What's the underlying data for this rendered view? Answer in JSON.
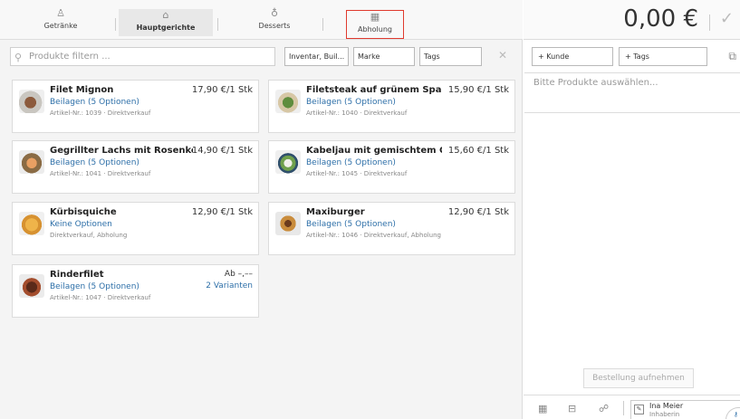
{
  "tabs": [
    {
      "label": "Getränke",
      "icon": "bottle-icon",
      "glyph": "♙"
    },
    {
      "label": "Hauptgerichte",
      "icon": "cloche-icon",
      "glyph": "⌂"
    },
    {
      "label": "Desserts",
      "icon": "ice-cream-icon",
      "glyph": "♁"
    },
    {
      "label": "Abholung",
      "icon": "calendar-box-icon",
      "glyph": "▦"
    }
  ],
  "filter": {
    "search_placeholder": "Produkte filtern ...",
    "inventory": "Inventar, Buil...",
    "brand": "Marke",
    "tags": "Tags",
    "clear": "✕"
  },
  "products": [
    {
      "name": "Filet Mignon",
      "price": "17,90 €/1 Stk",
      "options": "Beilagen (5 Optionen)",
      "meta": "Artikel-Nr.: 1039 · Direktverkauf"
    },
    {
      "name": "Filetsteak auf grünem Spargel",
      "price": "15,90 €/1 Stk",
      "options": "Beilagen (5 Optionen)",
      "meta": "Artikel-Nr.: 1040 · Direktverkauf"
    },
    {
      "name": "Gegrillter Lachs mit Rosenkohl",
      "price": "14,90 €/1 Stk",
      "options": "Beilagen (5 Optionen)",
      "meta": "Artikel-Nr.: 1041 · Direktverkauf"
    },
    {
      "name": "Kabeljau mit gemischtem Gem...",
      "price": "15,60 €/1 Stk",
      "options": "Beilagen (5 Optionen)",
      "meta": "Artikel-Nr.: 1045 · Direktverkauf"
    },
    {
      "name": "Kürbisquiche",
      "price": "12,90 €/1 Stk",
      "options": "Keine Optionen",
      "meta": "Direktverkauf, Abholung"
    },
    {
      "name": "Maxiburger",
      "price": "12,90 €/1 Stk",
      "options": "Beilagen (5 Optionen)",
      "meta": "Artikel-Nr.: 1046 · Direktverkauf, Abholung"
    },
    {
      "name": "Rinderfilet",
      "price": "Ab –,––",
      "price2": "2 Varianten",
      "options": "Beilagen (5 Optionen)",
      "meta": "Artikel-Nr.: 1047 · Direktverkauf"
    }
  ],
  "order": {
    "total": "0,00 €",
    "customer_btn": "+ Kunde",
    "tags_btn": "+ Tags",
    "hint": "Bitte Produkte auswählen...",
    "submit": "Bestellung aufnehmen"
  },
  "user": {
    "name": "Ina Meier",
    "role": "Inhaberin"
  }
}
